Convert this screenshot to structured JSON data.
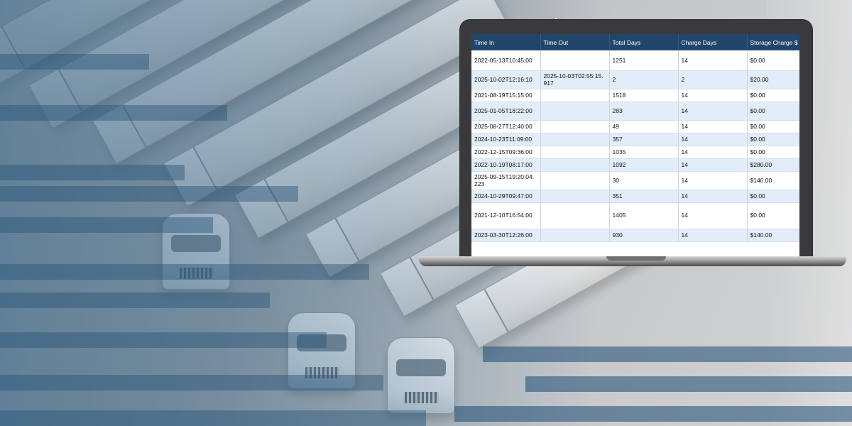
{
  "table": {
    "headers": [
      "Time In",
      "Time Out",
      "Total Days",
      "Charge Days",
      "Storage Charge $"
    ],
    "rows": [
      {
        "time_in": "2022-05-13T10:45:00",
        "time_out": "",
        "total_days": "1251",
        "charge_days": "14",
        "storage_charge": "$0.00"
      },
      {
        "time_in": "2025-10-02T12:16:10",
        "time_out": "2025-10-03T02:55:15.917",
        "total_days": "2",
        "charge_days": "2",
        "storage_charge": "$20.00"
      },
      {
        "time_in": "2021-08-19T15:15:00",
        "time_out": "",
        "total_days": "1518",
        "charge_days": "14",
        "storage_charge": "$0.00"
      },
      {
        "time_in": "2025-01-05T18:22:00",
        "time_out": "",
        "total_days": "283",
        "charge_days": "14",
        "storage_charge": "$0.00"
      },
      {
        "time_in": "2025-08-27T12:40:00",
        "time_out": "",
        "total_days": "49",
        "charge_days": "14",
        "storage_charge": "$0.00"
      },
      {
        "time_in": "2024-10-23T11:09:00",
        "time_out": "",
        "total_days": "357",
        "charge_days": "14",
        "storage_charge": "$0.00"
      },
      {
        "time_in": "2022-12-15T09:36:00",
        "time_out": "",
        "total_days": "1035",
        "charge_days": "14",
        "storage_charge": "$0.00"
      },
      {
        "time_in": "2022-10-19T08:17:00",
        "time_out": "",
        "total_days": "1092",
        "charge_days": "14",
        "storage_charge": "$280.00"
      },
      {
        "time_in": "2025-09-15T19:20:04.223",
        "time_out": "",
        "total_days": "30",
        "charge_days": "14",
        "storage_charge": "$140.00"
      },
      {
        "time_in": "2024-10-29T09:47:00",
        "time_out": "",
        "total_days": "351",
        "charge_days": "14",
        "storage_charge": "$0.00"
      },
      {
        "time_in": "2021-12-10T16:54:00",
        "time_out": "",
        "total_days": "1405",
        "charge_days": "14",
        "storage_charge": "$0.00"
      },
      {
        "time_in": "2023-03-30T12:26:00",
        "time_out": "",
        "total_days": "930",
        "charge_days": "14",
        "storage_charge": "$140.00"
      }
    ]
  },
  "colors": {
    "header_bg": "#22466b",
    "row_alt_bg": "#e1edf9",
    "background_tint": "#466e8c"
  }
}
